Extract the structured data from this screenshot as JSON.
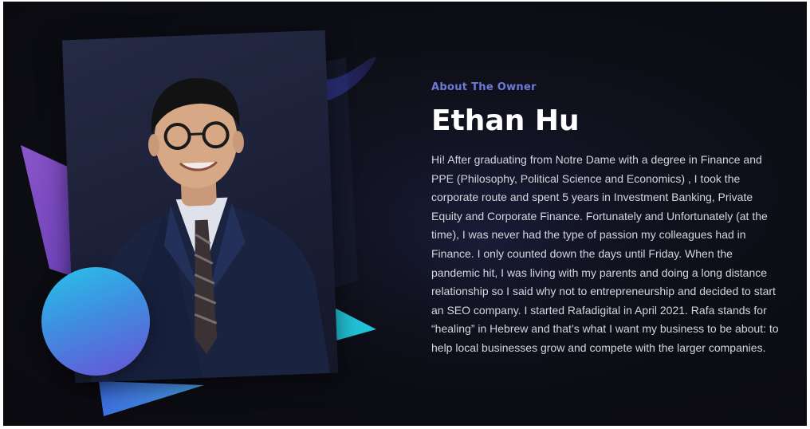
{
  "about": {
    "eyebrow": "About The Owner",
    "name": "Ethan Hu",
    "bio": "Hi! After graduating from Notre Dame with a degree in Finance and PPE (Philosophy, Political Science and Economics) , I took the corporate route and spent 5 years in Investment Banking, Private Equity and Corporate Finance. Fortunately and Unfortunately (at the time), I was never had the type of passion my colleagues had in Finance. I only counted down the days until Friday. When the pandemic hit, I was living with my parents and doing a long distance relationship so I said why not to entrepreneurship and decided to start an SEO company. I started Rafadigital in April 2021. Rafa stands for “healing” in Hebrew and that’s what I want my business to be about: to help local businesses grow and compete with the larger companies."
  },
  "colors": {
    "background": "#0b0b12",
    "accent": "#6d7bd8",
    "purple_shape": "#7b4fc4",
    "cyan_shape": "#21c2d6",
    "blue_shape": "#3d7fe0"
  }
}
